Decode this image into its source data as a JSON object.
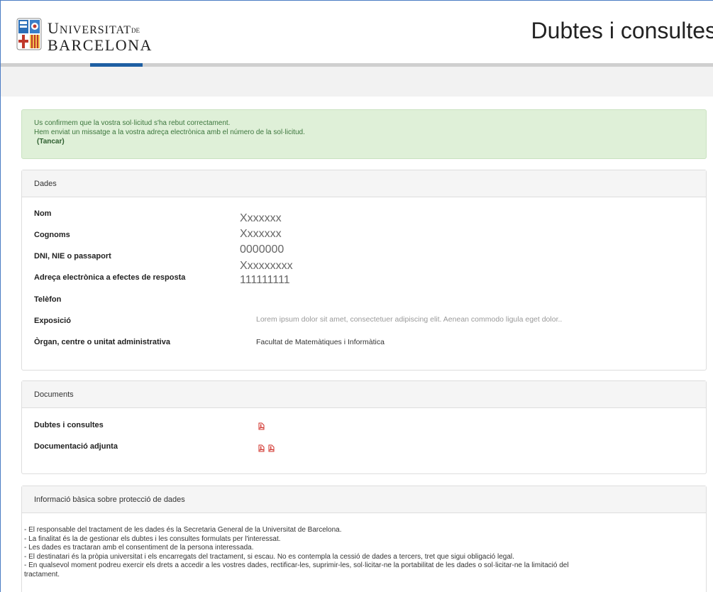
{
  "header": {
    "logo": {
      "line1_main": "U",
      "line1_rest": "NIVERSITAT",
      "line1_de": "DE",
      "line2": "BARCELONA"
    },
    "title": "Dubtes i consultes"
  },
  "alert": {
    "line1": "Us confirmem que la vostra sol·licitud s'ha rebut correctament.",
    "line2": "Hem enviat un missatge a la vostra adreça electrònica amb el número de la sol·licitud.",
    "close_label": "(Tancar)"
  },
  "dades": {
    "heading": "Dades",
    "fields": [
      {
        "label": "Nom",
        "value": "Xxxxxxx"
      },
      {
        "label": "Cognoms",
        "value": "Xxxxxxx"
      },
      {
        "label": "DNI, NIE o passaport",
        "value": "0000000"
      },
      {
        "label": "Adreça electrònica a efectes de resposta",
        "value": "Xxxxxxxxx"
      },
      {
        "label": "Telèfon",
        "value": "111111111"
      },
      {
        "label": "Exposició",
        "value": "Lorem ipsum dolor sit amet, consectetuer adipiscing elit. Aenean commodo ligula eget dolor.."
      },
      {
        "label": "Òrgan, centre o unitat administrativa",
        "value": "Facultat de Matemàtiques i Informàtica"
      }
    ]
  },
  "documents": {
    "heading": "Documents",
    "rows": [
      {
        "label": "Dubtes i consultes",
        "icons": [
          "pdf-icon"
        ]
      },
      {
        "label": "Documentació adjunta",
        "icons": [
          "pdf-icon",
          "pdf-icon"
        ]
      }
    ]
  },
  "proteccio": {
    "heading": "Informació bàsica sobre protecció de dades",
    "lines": [
      "- El responsable del tractament de les dades és la Secretaria General de la Universitat de Barcelona.",
      "- La finalitat és la de gestionar els dubtes i les consultes formulats per l'interessat.",
      "- Les dades es tractaran amb el consentiment de la persona interessada.",
      "- El destinatari és la pròpia universitat i els encarregats del tractament, si escau. No es contempla la cessió de dades a tercers, tret que sigui obligació legal.",
      "- En qualsevol moment podreu exercir els drets a accedir a les vostres dades, rectificar-les, suprimir-les, sol·licitar-ne la portabilitat de les dades o sol·licitar-ne la limitació del",
      "tractament."
    ]
  },
  "colors": {
    "accent": "#1f5fa3",
    "alert_bg": "#dff0d8",
    "alert_text": "#3c763d",
    "pdf_red": "#d0302a"
  }
}
